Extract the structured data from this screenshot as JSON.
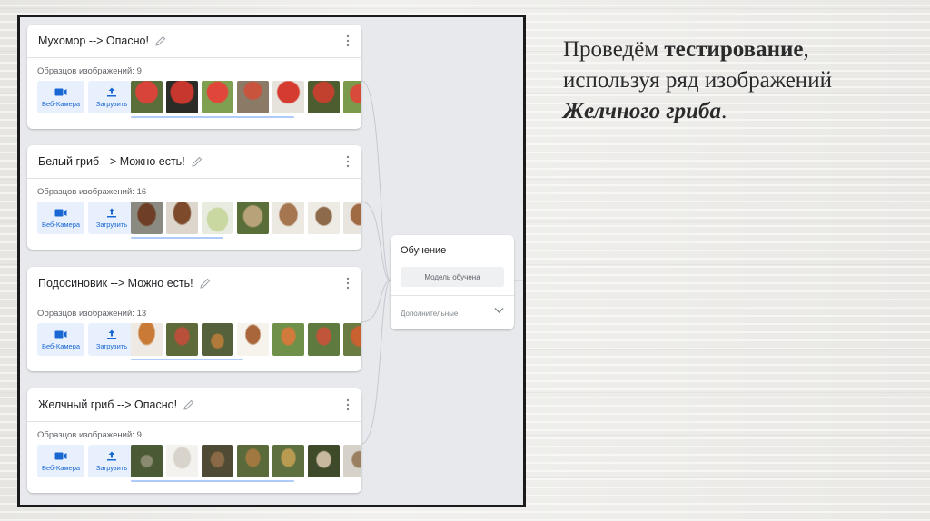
{
  "classes": [
    {
      "title": "Мухомор --> Опасно!",
      "samples_label": "Образцов изображений: 9",
      "thumbs": [
        "#c8372d",
        "#b9302a",
        "#d44a3a",
        "#8a6e52",
        "#c23a2e",
        "#a8503d",
        "#6f8e48"
      ]
    },
    {
      "title": "Белый гриб --> Можно есть!",
      "samples_label": "Образцов изображений: 16",
      "thumbs": [
        "#7a4a2e",
        "#8d5a3a",
        "#c8d3a6",
        "#9e8a63",
        "#b4906c",
        "#d8d0c2",
        "#a07048"
      ]
    },
    {
      "title": "Подосиновик --> Можно есть!",
      "samples_label": "Образцов изображений: 13",
      "thumbs": [
        "#c27a38",
        "#8a5d34",
        "#6b6a3a",
        "#f2ece4",
        "#6c8e4a",
        "#b55a3a",
        "#c05e33"
      ]
    },
    {
      "title": "Желчный гриб --> Опасно!",
      "samples_label": "Образцов изображений: 9",
      "thumbs": [
        "#5c7040",
        "#e6e2da",
        "#6b5a3f",
        "#8a6d40",
        "#a08a48",
        "#d8d0c4",
        "#8a7a60"
      ]
    }
  ],
  "buttons": {
    "webcam_label": "Веб-Камера",
    "upload_label": "Загрузить"
  },
  "training": {
    "title": "Обучение",
    "button_label": "Модель обучена",
    "advanced_label": "Дополнительные"
  },
  "slide": {
    "line1_plain": "Проведём ",
    "line1_bold": "тестирование",
    "line1_end": ",",
    "line2": "используя ряд изображений",
    "line3_bold_italic": "Желчного гриба",
    "line3_end": "."
  },
  "colors": {
    "accent": "#1967d2",
    "button_bg": "#e8f0fe",
    "scroll": "#aecbfa"
  }
}
